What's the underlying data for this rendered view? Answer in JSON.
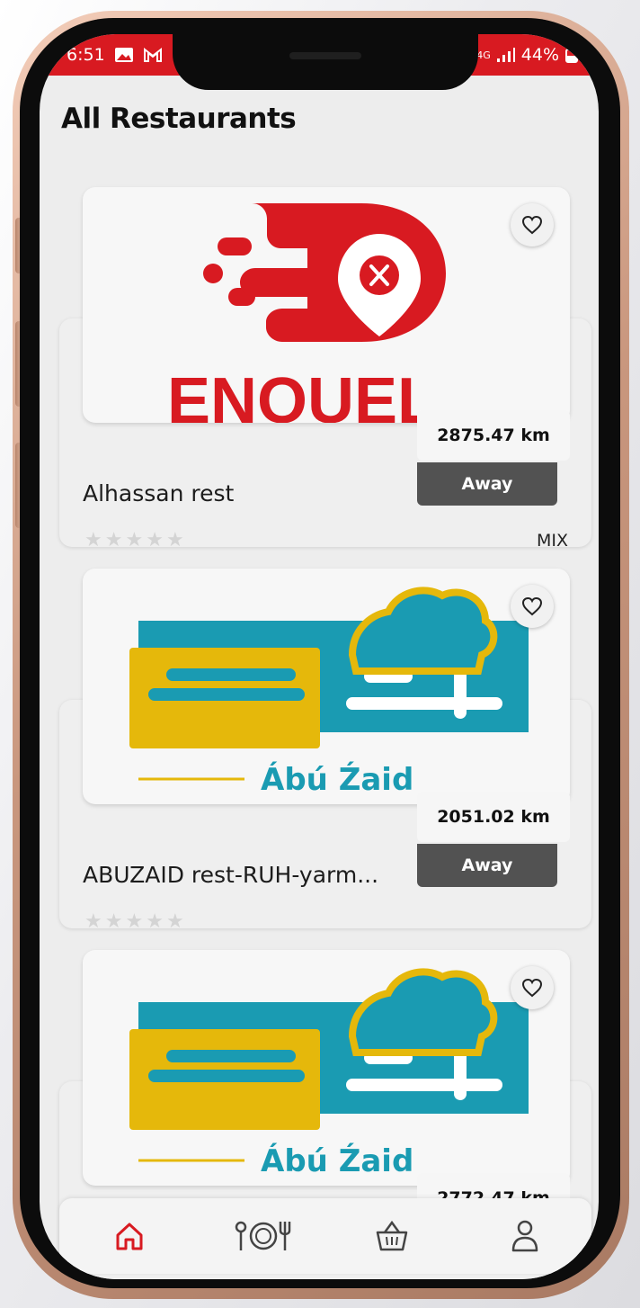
{
  "status_bar": {
    "time": "6:51",
    "network": "4G",
    "battery": "44%"
  },
  "page": {
    "title": "All Restaurants"
  },
  "restaurants": [
    {
      "name": "Alhassan rest",
      "distance": "2875.47 km",
      "status": "Away",
      "cuisine": "MIX",
      "rating": 0,
      "logo": "enouel-logo",
      "logo_text": "ENOUEL"
    },
    {
      "name": "ABUZAID rest-RUH-yarm...",
      "distance": "2051.02 km",
      "status": "Away",
      "cuisine": "",
      "rating": 0,
      "logo": "abu-zaid-logo",
      "logo_text": "Ábú Źaid"
    },
    {
      "name": "",
      "distance": "2772.47 km",
      "status": "",
      "cuisine": "",
      "rating": 0,
      "logo": "abu-zaid-logo",
      "logo_text": "Ábú Źaid"
    }
  ],
  "bottom_nav": {
    "items": [
      "home-icon",
      "restaurants-icon",
      "basket-icon",
      "profile-icon"
    ],
    "active": "home-icon"
  },
  "colors": {
    "brand_red": "#d81a21",
    "badge_gray": "#525252",
    "abu_teal": "#1a9bb2",
    "abu_yellow": "#e5b80b"
  }
}
